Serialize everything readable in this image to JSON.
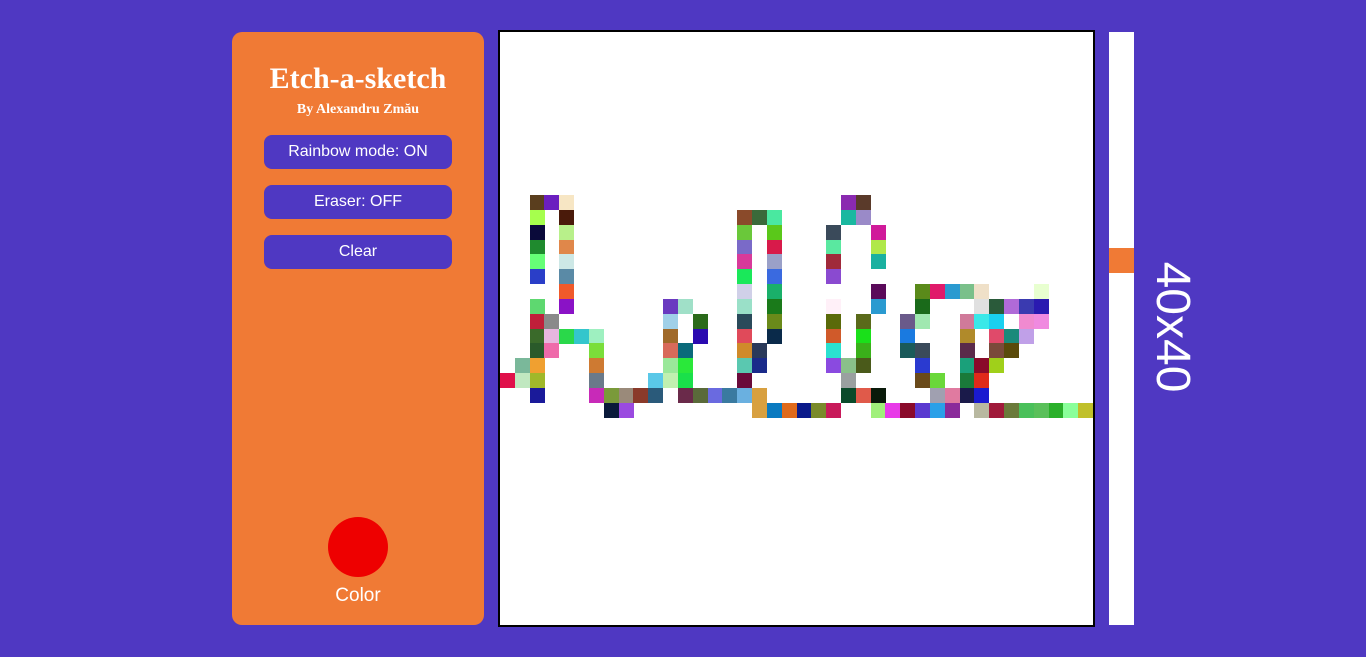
{
  "sidebar": {
    "title": "Etch-a-sketch",
    "author": "By Alexandru Zmău",
    "buttons": {
      "rainbow": "Rainbow mode: ON",
      "eraser": "Eraser: OFF",
      "clear": "Clear"
    },
    "color_label": "Color",
    "selected_color": "#ee0000"
  },
  "grid": {
    "size": 40,
    "size_label": "40x40",
    "slider_fraction": 0.38,
    "cells": [
      [
        2,
        11,
        "#5a3e1e"
      ],
      [
        3,
        11,
        "#6b1fbf"
      ],
      [
        4,
        11,
        "#f7e6c4"
      ],
      [
        2,
        12,
        "#a6ff4d"
      ],
      [
        4,
        12,
        "#4a1a0a"
      ],
      [
        2,
        13,
        "#0a0a3a"
      ],
      [
        4,
        13,
        "#b8f08a"
      ],
      [
        2,
        14,
        "#1f8a2e"
      ],
      [
        4,
        14,
        "#e0874a"
      ],
      [
        2,
        15,
        "#66ff77"
      ],
      [
        4,
        15,
        "#cde8e6"
      ],
      [
        2,
        16,
        "#2a3ec8"
      ],
      [
        4,
        16,
        "#5a8aa6"
      ],
      [
        4,
        17,
        "#f05a2a"
      ],
      [
        2,
        18,
        "#5ed870"
      ],
      [
        4,
        18,
        "#8a12c6"
      ],
      [
        2,
        19,
        "#c01f3a"
      ],
      [
        3,
        19,
        "#8a8a8a"
      ],
      [
        2,
        20,
        "#3a6a2a"
      ],
      [
        3,
        20,
        "#e7b6de"
      ],
      [
        4,
        20,
        "#2ad84a"
      ],
      [
        5,
        20,
        "#34c6cc"
      ],
      [
        6,
        20,
        "#9ef0c0"
      ],
      [
        2,
        21,
        "#2a5a2a"
      ],
      [
        3,
        21,
        "#ef6aaa"
      ],
      [
        6,
        21,
        "#7ade3a"
      ],
      [
        1,
        22,
        "#7ab89a"
      ],
      [
        2,
        22,
        "#f0a030"
      ],
      [
        6,
        22,
        "#ce7a32"
      ],
      [
        0,
        23,
        "#e0104a"
      ],
      [
        1,
        23,
        "#c0e8c0"
      ],
      [
        2,
        23,
        "#a0b82a"
      ],
      [
        6,
        23,
        "#6a7a8a"
      ],
      [
        2,
        24,
        "#1a1a9a"
      ],
      [
        6,
        24,
        "#c82ab8"
      ],
      [
        7,
        24,
        "#7a9a3a"
      ],
      [
        8,
        24,
        "#9a8a7a"
      ],
      [
        9,
        24,
        "#8a3a2a"
      ],
      [
        10,
        24,
        "#2a5a7a"
      ],
      [
        7,
        25,
        "#0a1a3a"
      ],
      [
        8,
        25,
        "#9a4ae0"
      ],
      [
        11,
        18,
        "#6a3ac0"
      ],
      [
        12,
        18,
        "#a0e0c8"
      ],
      [
        11,
        19,
        "#a0d0e8"
      ],
      [
        13,
        19,
        "#2a6a1a"
      ],
      [
        11,
        20,
        "#a06a2a"
      ],
      [
        13,
        20,
        "#2a0ab0"
      ],
      [
        11,
        21,
        "#d86a5a"
      ],
      [
        12,
        21,
        "#0a6a7a"
      ],
      [
        11,
        22,
        "#9ae89a"
      ],
      [
        12,
        22,
        "#2ae83a"
      ],
      [
        10,
        23,
        "#5ac8e8"
      ],
      [
        11,
        23,
        "#c0f0b0"
      ],
      [
        12,
        23,
        "#1ae04a"
      ],
      [
        12,
        24,
        "#6a2a4a"
      ],
      [
        13,
        24,
        "#5a6a3a"
      ],
      [
        14,
        24,
        "#6a6ae0"
      ],
      [
        15,
        24,
        "#3a7aa0"
      ],
      [
        16,
        24,
        "#6ab0e0"
      ],
      [
        17,
        24,
        "#e0a030"
      ],
      [
        16,
        12,
        "#8a4a2a"
      ],
      [
        17,
        12,
        "#3a6a3a"
      ],
      [
        18,
        12,
        "#4ae8a0"
      ],
      [
        16,
        13,
        "#6ac83a"
      ],
      [
        18,
        13,
        "#5ac81a"
      ],
      [
        16,
        14,
        "#7a6ac8"
      ],
      [
        18,
        14,
        "#d81a4a"
      ],
      [
        16,
        15,
        "#d83a9a"
      ],
      [
        18,
        15,
        "#9aa0c8"
      ],
      [
        16,
        16,
        "#1ae85a"
      ],
      [
        18,
        16,
        "#3a6ae0"
      ],
      [
        16,
        17,
        "#d0d0e8"
      ],
      [
        18,
        17,
        "#1ab06a"
      ],
      [
        16,
        18,
        "#9ae0c8"
      ],
      [
        18,
        18,
        "#1a7a1a"
      ],
      [
        16,
        19,
        "#2a4a5a"
      ],
      [
        18,
        19,
        "#6a8a1a"
      ],
      [
        16,
        20,
        "#e04a5a"
      ],
      [
        18,
        20,
        "#0a2a4a"
      ],
      [
        16,
        21,
        "#d08a2a"
      ],
      [
        17,
        21,
        "#2a3a5a"
      ],
      [
        16,
        22,
        "#5ac8b0"
      ],
      [
        17,
        22,
        "#1a2a8a"
      ],
      [
        16,
        23,
        "#6a0a3a"
      ],
      [
        17,
        23,
        "#ffffff"
      ],
      [
        17,
        24,
        "#d8a040"
      ],
      [
        17,
        25,
        "#d8a040"
      ],
      [
        18,
        25,
        "#0a7ac0"
      ],
      [
        19,
        25,
        "#e06a1a"
      ],
      [
        20,
        25,
        "#0a1a8a"
      ],
      [
        21,
        25,
        "#7a8a2a"
      ],
      [
        22,
        25,
        "#c81a5a"
      ],
      [
        23,
        11,
        "#8a2ab0"
      ],
      [
        24,
        11,
        "#5a3a2a"
      ],
      [
        23,
        12,
        "#1ab8a0"
      ],
      [
        24,
        12,
        "#9a8ac8"
      ],
      [
        22,
        13,
        "#3a4a5a"
      ],
      [
        25,
        13,
        "#d01a9a"
      ],
      [
        22,
        14,
        "#5ae8a0"
      ],
      [
        25,
        14,
        "#b0e84a"
      ],
      [
        22,
        15,
        "#a02a3a"
      ],
      [
        25,
        15,
        "#1ab0a0"
      ],
      [
        22,
        16,
        "#8a4ad0"
      ],
      [
        25,
        17,
        "#5a0a5a"
      ],
      [
        22,
        18,
        "#fff0f8"
      ],
      [
        25,
        18,
        "#2a9ad0"
      ],
      [
        22,
        19,
        "#5a6a0a"
      ],
      [
        24,
        19,
        "#5a6a1a"
      ],
      [
        22,
        20,
        "#d05a2a"
      ],
      [
        24,
        20,
        "#1ae01a"
      ],
      [
        22,
        21,
        "#2ae0d0"
      ],
      [
        24,
        21,
        "#3ab01a"
      ],
      [
        22,
        22,
        "#8a4ae0"
      ],
      [
        23,
        22,
        "#8ac08a"
      ],
      [
        24,
        22,
        "#4a5a1a"
      ],
      [
        23,
        23,
        "#9aa0a0"
      ],
      [
        23,
        24,
        "#0a4a2a"
      ],
      [
        24,
        24,
        "#e05a4a"
      ],
      [
        25,
        24,
        "#0a1a0a"
      ],
      [
        25,
        25,
        "#a0f07a"
      ],
      [
        26,
        25,
        "#e83ae8"
      ],
      [
        27,
        25,
        "#8a0a2a"
      ],
      [
        28,
        25,
        "#5a3ad0"
      ],
      [
        29,
        25,
        "#2aa0e8"
      ],
      [
        30,
        25,
        "#8a2a9a"
      ],
      [
        28,
        17,
        "#5a8a1a"
      ],
      [
        29,
        17,
        "#e01a6a"
      ],
      [
        30,
        17,
        "#2a9ad0"
      ],
      [
        31,
        17,
        "#7ac08a"
      ],
      [
        32,
        17,
        "#efe0c8"
      ],
      [
        28,
        18,
        "#1a6a1a"
      ],
      [
        32,
        18,
        "#e0e0e0"
      ],
      [
        33,
        18,
        "#2a5a3a"
      ],
      [
        34,
        18,
        "#b06ad8"
      ],
      [
        27,
        19,
        "#6a5a8a"
      ],
      [
        28,
        19,
        "#a0e8b0"
      ],
      [
        31,
        19,
        "#d07a9a"
      ],
      [
        32,
        19,
        "#3ae8e8"
      ],
      [
        33,
        19,
        "#1ad0f0"
      ],
      [
        27,
        20,
        "#1a7ae0"
      ],
      [
        31,
        20,
        "#b08a2a"
      ],
      [
        33,
        20,
        "#e04a6a"
      ],
      [
        34,
        20,
        "#1a8a7a"
      ],
      [
        27,
        21,
        "#1a5a5a"
      ],
      [
        28,
        21,
        "#3a4a5a"
      ],
      [
        31,
        21,
        "#5a2a4a"
      ],
      [
        33,
        21,
        "#7a4a3a"
      ],
      [
        34,
        21,
        "#5a4a0a"
      ],
      [
        28,
        22,
        "#2a3ad0"
      ],
      [
        31,
        22,
        "#1aa07a"
      ],
      [
        32,
        22,
        "#8a0a2a"
      ],
      [
        33,
        22,
        "#a0d01a"
      ],
      [
        28,
        23,
        "#6a4a1a"
      ],
      [
        29,
        23,
        "#6ad83a"
      ],
      [
        31,
        23,
        "#1a7a3a"
      ],
      [
        32,
        23,
        "#e02a1a"
      ],
      [
        29,
        24,
        "#a0a0b0"
      ],
      [
        30,
        24,
        "#e07aa0"
      ],
      [
        31,
        24,
        "#1a1a4a"
      ],
      [
        32,
        24,
        "#1a1ad0"
      ],
      [
        32,
        25,
        "#b8b8a0"
      ],
      [
        33,
        25,
        "#a01a3a"
      ],
      [
        34,
        25,
        "#6a7a3a"
      ],
      [
        35,
        25,
        "#4ac05a"
      ],
      [
        36,
        25,
        "#5ac05a"
      ],
      [
        37,
        25,
        "#2ab02a"
      ],
      [
        38,
        25,
        "#8aff9a"
      ],
      [
        39,
        25,
        "#c0c02a"
      ],
      [
        35,
        18,
        "#3a3ab0"
      ],
      [
        36,
        18,
        "#2a1ab0"
      ],
      [
        35,
        19,
        "#f08ad0"
      ],
      [
        36,
        19,
        "#f08ae0"
      ],
      [
        35,
        20,
        "#c0a0e8"
      ],
      [
        36,
        17,
        "#e8ffd0"
      ]
    ]
  }
}
